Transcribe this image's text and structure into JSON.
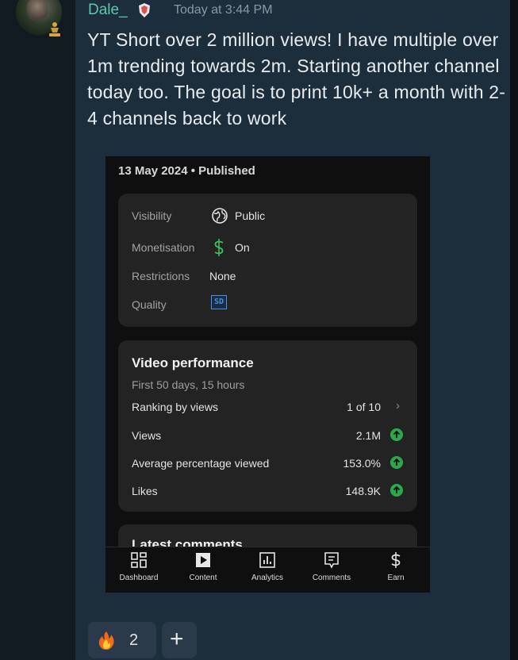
{
  "message": {
    "username": "Dale_",
    "timestamp": "Today at 3:44 PM",
    "text": "YT Short over 2 million views! I have multiple over 1m trending towards 2m. Starting another channel today too. The goal is to print 10k+ a month with 2-4 channels back to work"
  },
  "screenshot": {
    "date_status": "13 May 2024 • Published",
    "details": [
      {
        "label": "Visibility",
        "value": "Public",
        "icon": "globe-icon"
      },
      {
        "label": "Monetisation",
        "value": "On",
        "icon": "dollar-icon"
      },
      {
        "label": "Restrictions",
        "value": "None"
      },
      {
        "label": "Quality",
        "value": "SD",
        "icon": "sd-badge-icon"
      }
    ],
    "performance": {
      "title": "Video performance",
      "subtitle": "First 50 days, 15 hours",
      "rows": [
        {
          "label": "Ranking by views",
          "value": "1 of 10"
        },
        {
          "label": "Views",
          "value": "2.1M"
        },
        {
          "label": "Average percentage viewed",
          "value": "153.0%"
        },
        {
          "label": "Likes",
          "value": "148.9K"
        }
      ]
    },
    "latest_comments_title": "Latest comments",
    "nav": [
      {
        "label": "Dashboard",
        "icon": "dashboard-icon"
      },
      {
        "label": "Content",
        "icon": "content-icon"
      },
      {
        "label": "Analytics",
        "icon": "analytics-icon"
      },
      {
        "label": "Comments",
        "icon": "comments-icon"
      },
      {
        "label": "Earn",
        "icon": "earn-icon"
      }
    ],
    "colors": {
      "accent_green": "#2ba84a",
      "dollar_green": "#3fbf5f",
      "sd_blue": "#4a90e2"
    }
  },
  "reactions": {
    "fire_count": "2",
    "add_label": "+"
  },
  "colors": {
    "username": "#5fc9b0",
    "panel": "#1c2d3c"
  }
}
